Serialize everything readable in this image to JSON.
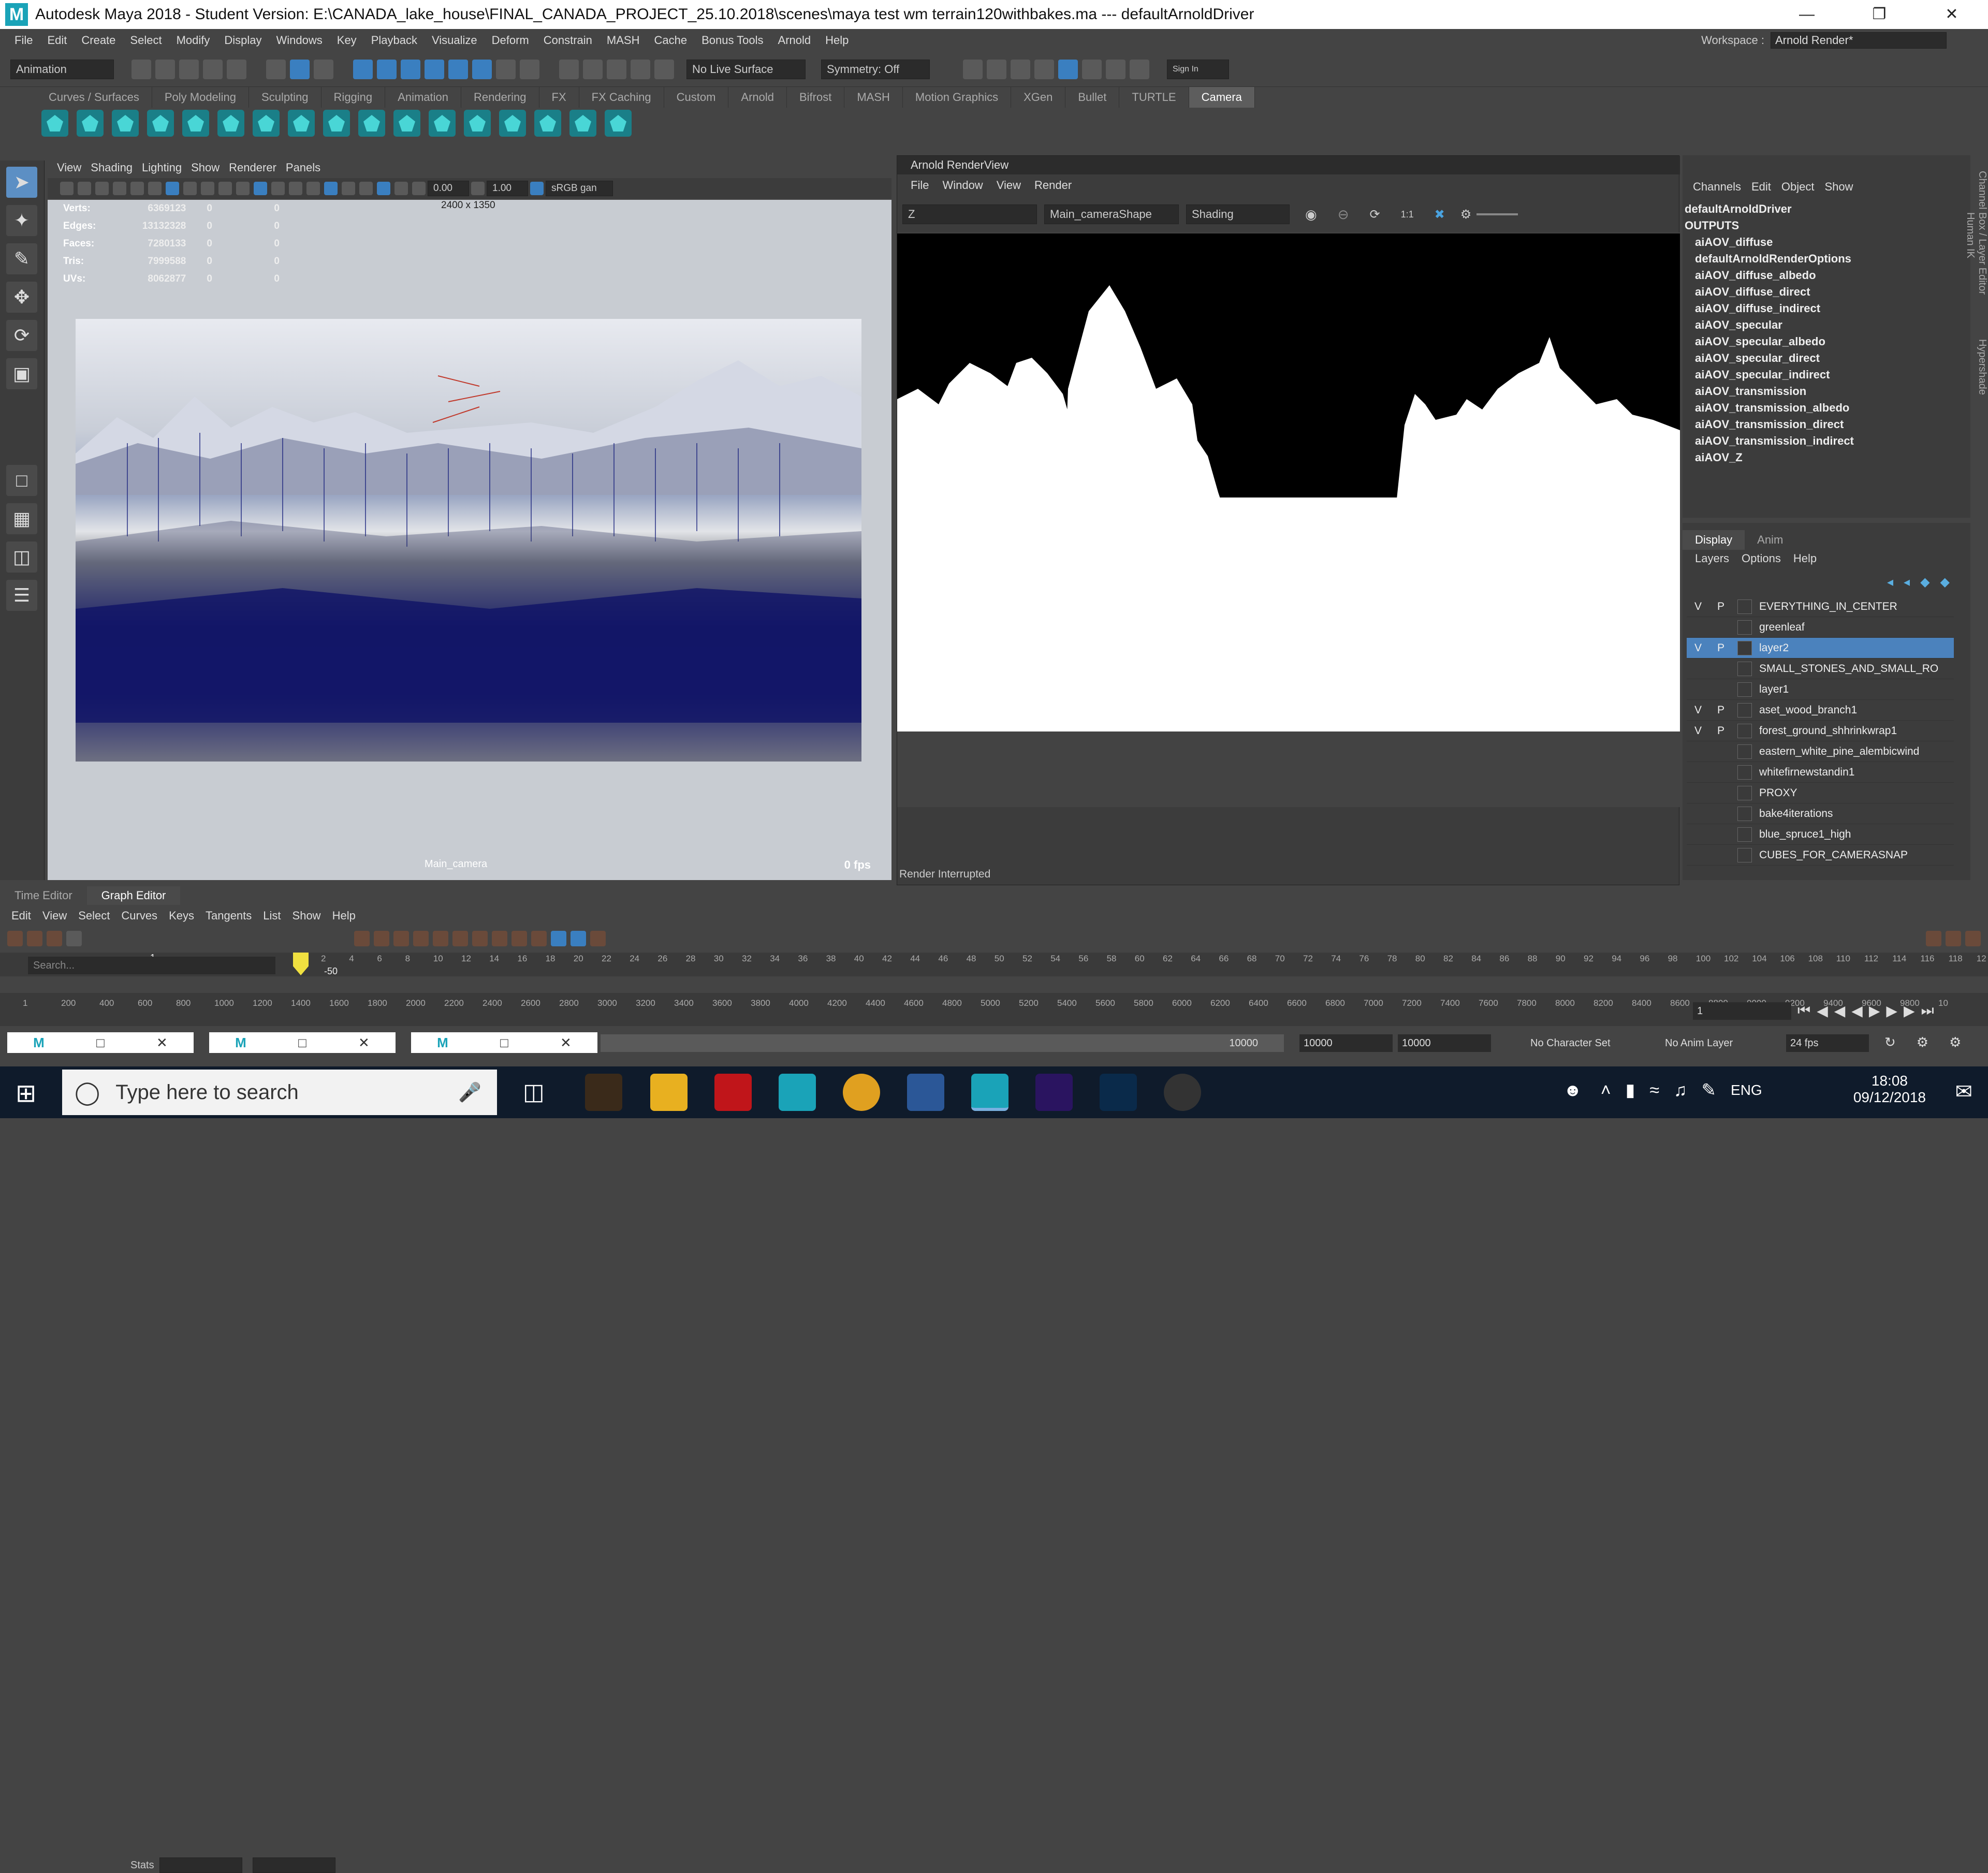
{
  "window": {
    "title": "Autodesk Maya 2018 - Student Version: E:\\CANADA_lake_house\\FINAL_CANADA_PROJECT_25.10.2018\\scenes\\maya test wm terrain120withbakes.ma    ---    defaultArnoldDriver",
    "logo": "M"
  },
  "menubar": {
    "items": [
      "File",
      "Edit",
      "Create",
      "Select",
      "Modify",
      "Display",
      "Windows",
      "Key",
      "Playback",
      "Visualize",
      "Deform",
      "Constrain",
      "MASH",
      "Cache",
      "Bonus Tools",
      "Arnold",
      "Help"
    ],
    "workspace_label": "Workspace :",
    "workspace_value": "Arnold Render*"
  },
  "statusline": {
    "mode": "Animation",
    "live_surface": "No Live Surface",
    "symmetry": "Symmetry: Off",
    "sign_in": "Sign In"
  },
  "shelf": {
    "tabs": [
      "Curves / Surfaces",
      "Poly Modeling",
      "Sculpting",
      "Rigging",
      "Animation",
      "Rendering",
      "FX",
      "FX Caching",
      "Custom",
      "Arnold",
      "Bifrost",
      "MASH",
      "Motion Graphics",
      "XGen",
      "Bullet",
      "TURTLE",
      "Camera"
    ],
    "active_tab": "Camera",
    "icon_count_label": "camera-shelf-icon"
  },
  "viewport": {
    "menu": [
      "View",
      "Shading",
      "Lighting",
      "Show",
      "Renderer",
      "Panels"
    ],
    "field_a": "0.00",
    "field_b": "1.00",
    "color_space": "sRGB gan",
    "resolution_gate": "2400 x 1350",
    "hud": [
      {
        "label": "Verts:",
        "value": "6369123",
        "a": "0",
        "b": "0"
      },
      {
        "label": "Edges:",
        "value": "13132328",
        "a": "0",
        "b": "0"
      },
      {
        "label": "Faces:",
        "value": "7280133",
        "a": "0",
        "b": "0"
      },
      {
        "label": "Tris:",
        "value": "7999588",
        "a": "0",
        "b": "0"
      },
      {
        "label": "UVs:",
        "value": "8062877",
        "a": "0",
        "b": "0"
      }
    ],
    "camera_name": "Main_camera",
    "fps": "0 fps"
  },
  "renderview": {
    "title": "Arnold RenderView",
    "menu": [
      "File",
      "Window",
      "View",
      "Render"
    ],
    "aov": "Z",
    "camera": "Main_cameraShape",
    "mode": "Shading",
    "ratio": "1:1",
    "status": "Render Interrupted"
  },
  "channelbox": {
    "menu": [
      "Channels",
      "Edit",
      "Object",
      "Show"
    ],
    "node": "defaultArnoldDriver",
    "section": "OUTPUTS",
    "outputs": [
      "aiAOV_diffuse",
      "defaultArnoldRenderOptions",
      "aiAOV_diffuse_albedo",
      "aiAOV_diffuse_direct",
      "aiAOV_diffuse_indirect",
      "aiAOV_specular",
      "aiAOV_specular_albedo",
      "aiAOV_specular_direct",
      "aiAOV_specular_indirect",
      "aiAOV_transmission",
      "aiAOV_transmission_albedo",
      "aiAOV_transmission_direct",
      "aiAOV_transmission_indirect",
      "aiAOV_Z"
    ]
  },
  "layereditor": {
    "tabs": [
      "Display",
      "Anim"
    ],
    "active_tab": "Display",
    "menu": [
      "Layers",
      "Options",
      "Help"
    ],
    "layers": [
      {
        "v": "V",
        "p": "P",
        "name": "EVERYTHING_IN_CENTER",
        "selected": false
      },
      {
        "v": "",
        "p": "",
        "name": "greenleaf",
        "selected": false
      },
      {
        "v": "V",
        "p": "P",
        "name": "layer2",
        "selected": true
      },
      {
        "v": "",
        "p": "",
        "name": "SMALL_STONES_AND_SMALL_RO",
        "selected": false
      },
      {
        "v": "",
        "p": "",
        "name": "layer1",
        "selected": false
      },
      {
        "v": "V",
        "p": "P",
        "name": "aset_wood_branch1",
        "selected": false
      },
      {
        "v": "V",
        "p": "P",
        "name": "forest_ground_shhrinkwrap1",
        "selected": false
      },
      {
        "v": "",
        "p": "",
        "name": "eastern_white_pine_alembicwind",
        "selected": false
      },
      {
        "v": "",
        "p": "",
        "name": "whitefirnewstandin1",
        "selected": false
      },
      {
        "v": "",
        "p": "",
        "name": "PROXY",
        "selected": false
      },
      {
        "v": "",
        "p": "",
        "name": "bake4iterations",
        "selected": false
      },
      {
        "v": "",
        "p": "",
        "name": "blue_spruce1_high",
        "selected": false
      },
      {
        "v": "",
        "p": "",
        "name": "CUBES_FOR_CAMERASNAP",
        "selected": false
      }
    ]
  },
  "sidetabs": {
    "channel": "Channel Box / Layer Editor",
    "hypershade": "Hypershade",
    "humanik": "Human IK"
  },
  "grapheditor": {
    "tabs": [
      "Time Editor",
      "Graph Editor"
    ],
    "active_tab": "Graph Editor",
    "menu": [
      "Edit",
      "View",
      "Select",
      "Curves",
      "Keys",
      "Tangents",
      "List",
      "Show",
      "Help"
    ],
    "stats_label": "Stats",
    "search_placeholder": "Search...",
    "frame_top": "1",
    "frame_neg": "-50",
    "ticks": [
      "2",
      "4",
      "6",
      "8",
      "10",
      "12",
      "14",
      "16",
      "18",
      "20",
      "22",
      "24",
      "26",
      "28",
      "30",
      "32",
      "34",
      "36",
      "38",
      "40",
      "42",
      "44",
      "46",
      "48",
      "50",
      "52",
      "54",
      "56",
      "58",
      "60",
      "62",
      "64",
      "66",
      "68",
      "70",
      "72",
      "74",
      "76",
      "78",
      "80",
      "82",
      "84",
      "86",
      "88",
      "90",
      "92",
      "94",
      "96",
      "98",
      "100",
      "102",
      "104",
      "106",
      "108",
      "110",
      "112",
      "114",
      "116",
      "118",
      "12"
    ]
  },
  "timeslider": {
    "ticks": [
      "1",
      "200",
      "400",
      "600",
      "800",
      "1000",
      "1200",
      "1400",
      "1600",
      "1800",
      "2000",
      "2200",
      "2400",
      "2600",
      "2800",
      "3000",
      "3200",
      "3400",
      "3600",
      "3800",
      "4000",
      "4200",
      "4400",
      "4600",
      "4800",
      "5000",
      "5200",
      "5400",
      "5600",
      "5800",
      "6000",
      "6200",
      "6400",
      "6600",
      "6800",
      "7000",
      "7200",
      "7400",
      "7600",
      "7800",
      "8000",
      "8200",
      "8400",
      "8600",
      "8800",
      "9000",
      "9200",
      "9400",
      "9600",
      "9800",
      "10"
    ],
    "current_frame": "1"
  },
  "rangebar": {
    "range_end": "10000",
    "end_a": "10000",
    "end_b": "10000",
    "char_set": "No Character Set",
    "anim_layer": "No Anim Layer",
    "fps": "24 fps"
  },
  "taskbar": {
    "search_placeholder": "Type here to search",
    "language": "ENG",
    "time": "18:08",
    "date": "09/12/2018"
  }
}
